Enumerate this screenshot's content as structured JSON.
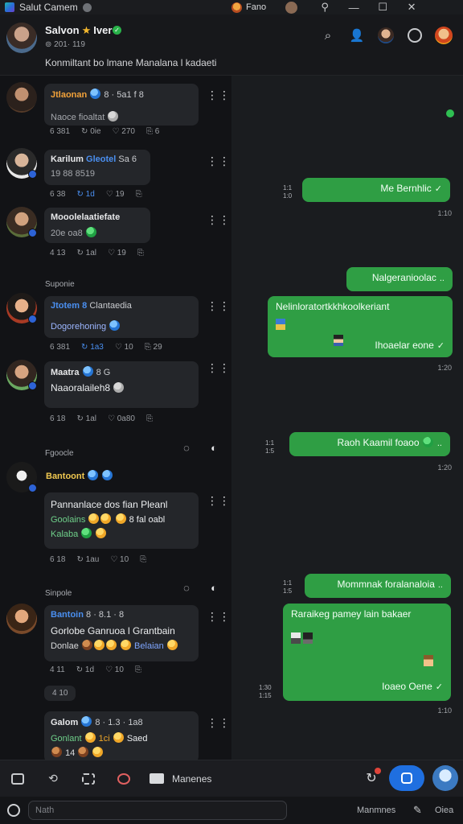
{
  "window": {
    "title": "Salut Camem",
    "user_name": "Fano",
    "controls": {
      "minimize": "—",
      "maximize": "☐",
      "close": "✕"
    }
  },
  "header": {
    "name_a": "Salvon",
    "name_b": "Iver",
    "star": "★",
    "verified": "✓",
    "sub": "⊚ 201· 119",
    "description": "Konmiltant bo lmane Manalana l kadaeti",
    "icons": [
      "search-icon",
      "person-icon",
      "profile-icon",
      "settings-icon",
      "account-icon"
    ]
  },
  "posts": [
    {
      "author": "Jtlaonan",
      "author_extra": "8 · 5a1",
      "tag": "f 8",
      "message": "Naoce fioaltat",
      "reactions": [
        "6 381",
        "↻ 0ie",
        "♡ 270",
        "⎘ 6"
      ]
    },
    {
      "author": "Karilum",
      "author_extra": "Gleotel",
      "tag": "Sa 6",
      "message": "19 88 8519",
      "reactions": [
        "6 38",
        "↻ 1d",
        "♡ 19",
        "⎘"
      ]
    },
    {
      "author": "Mooolelaatiefate",
      "author_extra": "",
      "tag": "",
      "message": "20e oa8",
      "reactions": [
        "4 13",
        "↻ 1al",
        "♡ 19",
        "⎘"
      ]
    },
    {
      "author": "Jtotem",
      "author_extra": "8",
      "tag": "Clantaedia",
      "message": "Dogorehoning",
      "reactions": [
        "6 381",
        "↻ 1a3",
        "♡ 10",
        "⎘ 29"
      ]
    },
    {
      "author": "Maatra",
      "author_extra": "8 G",
      "tag": "",
      "message": "Naaoralaileh8",
      "reactions": [
        "6 18",
        "↻ 1al",
        "♡ 0a80",
        "⎘"
      ]
    },
    {
      "author": "Bantoont",
      "author_extra": "",
      "tag": "",
      "message_line1": "Pannanlace dos fian Pleanl",
      "message_line2": "Goolains",
      "message_line2b": "8 fal oabl",
      "message_line3": "Kalaba",
      "reactions": [
        "6 18",
        "↻ 1au",
        "♡ 10",
        "⎘"
      ]
    },
    {
      "author": "Bantoin",
      "author_extra": "8 · 8.1 · 8",
      "tag": "",
      "message_line1": "Gorlobe Ganruoa l Grantbain",
      "message_line2": "Donlae",
      "message_line2b": "Belaian",
      "reactions": [
        "4 11",
        "↻ 1d",
        "♡ 10",
        "⎘"
      ]
    },
    {
      "author": "Galom",
      "author_extra": "8 · 1.3 · 1a8",
      "tag": "",
      "message_line1": "Gonlant",
      "message_line1b": "1ci",
      "message_line1c": "Saed",
      "message_line2": "14",
      "reactions": []
    }
  ],
  "days": [
    "Suponie",
    "Fgoocle",
    "Sinpole"
  ],
  "pill": "4 10",
  "outgoing": [
    {
      "text": "Me Bernhlic",
      "check": "✓",
      "time_l": "1:1",
      "time_r": "1:0",
      "time_below": "1:10"
    },
    {
      "text": "Nalgeranioolac",
      "check": "..",
      "time_below": ""
    },
    {
      "text": "Nelinloratortkkhkoolkeriant",
      "text2": "Ihoaelar eone",
      "check": "✓",
      "time_below": "1:20"
    },
    {
      "text": "Raoh Kaamil foaoo",
      "check": "..",
      "time_l": "1:1",
      "time_r": "1:5",
      "time_below": "1:20"
    },
    {
      "text": "Mommnak foralanaloia",
      "check": "..",
      "time_l": "1:1",
      "time_r": "1:5"
    },
    {
      "text": "Raraikeg pamey lain bakaer",
      "text2": "Ioaeo Oene",
      "check": "✓",
      "time_l": "1:30",
      "time_r": "1:15",
      "time_below": "1:10"
    }
  ],
  "toolbar": {
    "label": "Manenes",
    "icons": [
      "reply-icon",
      "refresh-icon",
      "gallery-icon",
      "camera-icon",
      "mail-icon",
      "notification-icon",
      "capture-icon",
      "avatar-icon"
    ]
  },
  "input": {
    "placeholder": "Nath",
    "label_a": "Manmnes",
    "label_b": "Oiea"
  },
  "colors": {
    "accent_green": "#2f9e44",
    "accent_blue": "#1f6fe0",
    "background": "#101113"
  }
}
